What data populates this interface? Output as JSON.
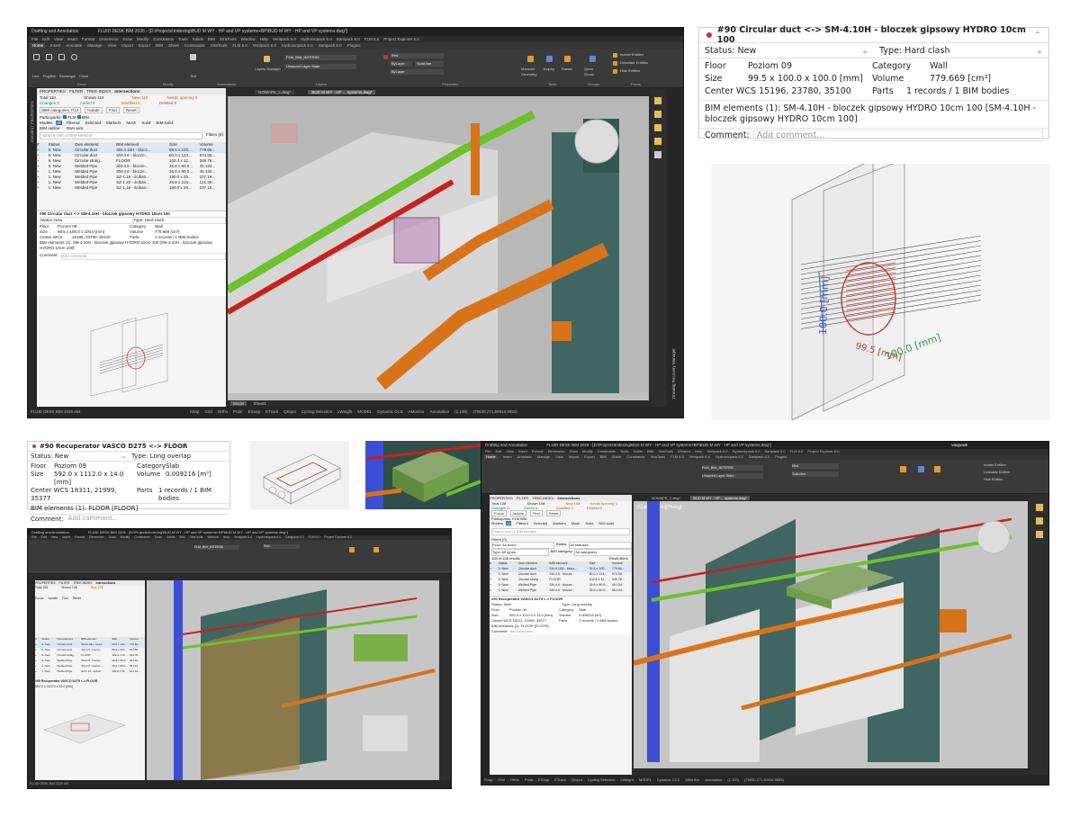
{
  "app": {
    "title": "FLUID DESK BIM 2026 - [D:\\Projects\\Indexing\\BUD M WY - HP and VP systems+BP\\BUD M WY - HP and VP systems.dwg*]",
    "workspace": "Drafting and Annotation",
    "menu": [
      "File",
      "Edit",
      "View",
      "Insert",
      "Format",
      "Dimension",
      "Draw",
      "Modify",
      "Constraints",
      "Tools",
      "Solids",
      "BIM",
      "XtraTools",
      "Window",
      "Help",
      "Ventpack 6.0",
      "Hydronicpack 6.0",
      "Sanipack 6.0",
      "FLM 6.0",
      "Project Explorer 6.0"
    ],
    "ribbon_tabs": [
      "Home",
      "Insert",
      "Annotate",
      "Manage",
      "View",
      "Import",
      "Export",
      "BIM",
      "Sheet",
      "Constraints",
      "XtraTools",
      "FLM 6.0",
      "Ventpack 6.0",
      "Hydronicpack 6.0",
      "Sanipack 6.0",
      "Plugins"
    ],
    "ribbon_groups": [
      "Draw",
      "Modify",
      "Annotations",
      "Layers",
      "Properties",
      "Tools",
      "Groups",
      "Focus"
    ],
    "ribbon_buttons": [
      "Line",
      "Polyline",
      "Rectangle",
      "Circle",
      "Text",
      "Layers Manager",
      "Measure Geometry",
      "Inquiry",
      "Flatten",
      "Quick Group",
      "Isolate Entities",
      "Unisolate Entities",
      "Hide Entities"
    ],
    "layer_value": "FLM_BIM_INTERSE",
    "layer_state": "Unsaved Layer State",
    "color_value": "Red",
    "linetype_value": "ByLayer",
    "linetype_style": "Solid line",
    "lineweight_value": "ByLayer",
    "doc_tabs": [
      "NOWAPE_2.dwg*",
      "BUD M WY - HP ... systems.dwg*"
    ],
    "model_tabs": [
      "Model",
      "Sheet1"
    ],
    "status_items": [
      "Snap",
      "Grid",
      "Ortho",
      "Polar",
      "ESnap",
      "ETrack",
      "QInput",
      "Cycling Selection",
      "LWeight",
      "MODEL",
      "Dynamic CCS",
      "AMonitor",
      "Annotation",
      "(1:100)",
      "(79630.271,50918.9553)"
    ],
    "status_left": "FLUID DESK BIM 2026 x64",
    "right_strip_label": "Drawing Recovery Manager",
    "left_strip_label": "ELEMENT PROPERTIES",
    "user": "vaupowk",
    "view_label": "[Custom View][Phong]"
  },
  "panel": {
    "tabs": [
      "PROPERTIES",
      "FILTER",
      "TREE-INDEX",
      "Intersections"
    ],
    "stats1": {
      "total": "Total 110",
      "shown": "Shown 110",
      "new": "New 110",
      "needs": "Needs opening 0",
      "changes": "Changes 0",
      "added": "Added 0",
      "modified": "Modified 0",
      "deleted": "Deleted 0"
    },
    "stats2": {
      "total": "Total 108",
      "shown": "Shown 108",
      "new": "New 108",
      "needs": "Needs opening 0",
      "changes": "Changes 0",
      "added": "Added 0",
      "modified": "Modified 0",
      "deleted": "Deleted 0"
    },
    "toolbar": [
      "BIM categories 7/14",
      "Isolate",
      "Find",
      "Reset"
    ],
    "toolbar2": [
      "Focus",
      "Isolate",
      "Find",
      "Reset"
    ],
    "participants_label": "Participants",
    "participants": [
      "FLM",
      "BIM"
    ],
    "models_label": "Models",
    "models": [
      "All",
      "Filtered",
      "Selected",
      "Markers",
      "Mesh",
      "Solid",
      "BIM solid"
    ],
    "models2": [
      "BIM outline",
      "Own wire"
    ],
    "search_placeholder": "Search own or BIM element",
    "filters_label": "Filters (6)",
    "filters_label2": "Filters (0)",
    "floor_filter": "Floor: All floors",
    "status_filter_label": "Status:",
    "status_filter": "All statuses",
    "type_filter": "Type: All types",
    "bim_category_filter_label": "BIM category:",
    "bim_category_filter": "All categories",
    "results": "108 of 108 results",
    "reset_filters": "Reset filters",
    "columns": [
      "#",
      "Status",
      "Own element",
      "BIM element",
      "Size",
      "Volume"
    ],
    "rows": [
      [
        "9. New",
        "Circular duct",
        "SM-4.10H - blocz...",
        "99.5 x 100....",
        "779.66..."
      ],
      [
        "9. New",
        "Circular duct",
        "SM-4.6 - blocze...",
        "80.0 x 124...",
        "974.58..."
      ],
      [
        "9. New",
        "Circular straig...",
        "FLOOR",
        "102.4 x 12...",
        "349.78..."
      ],
      [
        "9. New",
        "Welded Pipe",
        "SM-4.8 - blocze...",
        "26.8 x 80.0...",
        "45.134..."
      ],
      [
        "1. New",
        "Welded Pipe",
        "SM-4.8 - blocze...",
        "26.8 x 80.0...",
        "45.134..."
      ],
      [
        "1. New",
        "Welded Pipe",
        "SZ-1.16 - ściban...",
        "190.0 x 26...",
        "107.19..."
      ],
      [
        "1. New",
        "Welded Pipe",
        "SZ-1.20 - ściban...",
        "26.8 x 215...",
        "121.29..."
      ],
      [
        "1. New",
        "Welded Pipe",
        "SZ-1.16 - ściban...",
        "190.0 x 26...",
        "107.19..."
      ]
    ]
  },
  "card_duct": {
    "title": "#90  Circular duct <-> SM-4.10H - bloczek gipsowy HYDRO 10cm 100",
    "status_label": "Status:",
    "status": "New",
    "type_label": "Type:",
    "type": "Hard clash",
    "floor_label": "Floor",
    "floor": "Poziom 09",
    "category_label": "Category",
    "category": "Wall",
    "size_label": "Size",
    "size": "99.5 x 100.0 x 100.0 [mm]",
    "volume_label": "Volume",
    "volume": "779.669 [cm³]",
    "center_label": "Center WCS",
    "center": "15196, 23780, 35100",
    "parts_label": "Parts",
    "parts": "1 records / 1 BIM bodies",
    "bim_elements": "BIM elements (1): SM-4.10H - bloczek gipsowy HYDRO 10cm 100 [SM-4.10H - bloczek gipsowy HYDRO 10cm 100]",
    "comment_label": "Comment:",
    "comment_placeholder": "Add comment..."
  },
  "card_recuperator": {
    "title": "#90  Recuperator VASCO D275 <-> FLOOR",
    "status_label": "Status:",
    "status": "New",
    "type_label": "Type:",
    "type": "Long overlap",
    "floor_label": "Floor",
    "floor": "Poziom 09",
    "category_label": "Category",
    "category": "Slab",
    "size_label": "Size",
    "size": "592.0 x 1112.0 x 14.0 [mm]",
    "volume_label": "Volume",
    "volume": "0.009216 [m³]",
    "center_label": "Center WCS",
    "center": "18311, 21999, 35377",
    "parts_label": "Parts",
    "parts": "1 records / 1 BIM bodies",
    "bim_elements": "BIM elements (1): FLOOR [FLOOR]",
    "comment_label": "Comment:",
    "comment_placeholder": "Add comment..."
  },
  "dims": {
    "d1": "100.0 [mm]",
    "d2": "99.5 [mm]",
    "d3": "100.0 [mm]"
  },
  "colors": {
    "clash": "#c0392b",
    "pipe_orange": "#d9731a",
    "pipe_green": "#6cc12d",
    "pipe_red": "#c8201b",
    "duct_blue": "#3b4fd6",
    "wall_teal": "#3f6660",
    "ui_dark": "#2b2b2b",
    "accent_blue": "#1e73be"
  }
}
